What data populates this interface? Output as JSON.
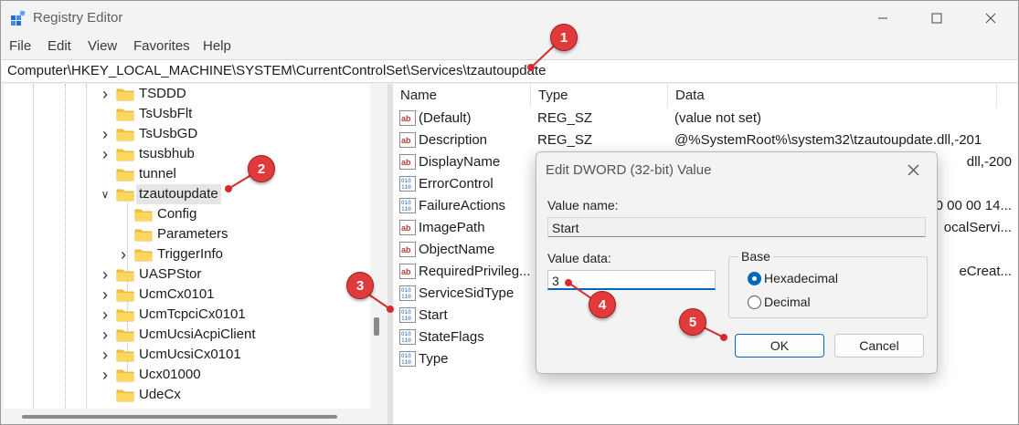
{
  "window": {
    "title": "Registry Editor",
    "minimize_icon": "minimize-icon",
    "maximize_icon": "maximize-icon",
    "close_icon": "close-icon"
  },
  "menu": [
    "File",
    "Edit",
    "View",
    "Favorites",
    "Help"
  ],
  "address": "Computer\\HKEY_LOCAL_MACHINE\\SYSTEM\\CurrentControlSet\\Services\\tzautoupdate",
  "tree": [
    {
      "label": "TSDDD",
      "has_children": true
    },
    {
      "label": "TsUsbFlt",
      "has_children": false
    },
    {
      "label": "TsUsbGD",
      "has_children": true
    },
    {
      "label": "tsusbhub",
      "has_children": true
    },
    {
      "label": "tunnel",
      "has_children": false
    },
    {
      "label": "tzautoupdate",
      "expanded": true,
      "selected": true
    },
    {
      "label": "Config",
      "child": true,
      "has_children": false
    },
    {
      "label": "Parameters",
      "child": true,
      "has_children": false
    },
    {
      "label": "TriggerInfo",
      "child": true,
      "has_children": true
    },
    {
      "label": "UASPStor",
      "has_children": true
    },
    {
      "label": "UcmCx0101",
      "has_children": true
    },
    {
      "label": "UcmTcpciCx0101",
      "has_children": true
    },
    {
      "label": "UcmUcsiAcpiClient",
      "has_children": true
    },
    {
      "label": "UcmUcsiCx0101",
      "has_children": true
    },
    {
      "label": "Ucx01000",
      "has_children": true
    },
    {
      "label": "UdeCx",
      "has_children": false
    }
  ],
  "columns": {
    "name": "Name",
    "type": "Type",
    "data": "Data"
  },
  "values": [
    {
      "name": "(Default)",
      "type": "REG_SZ",
      "data": "(value not set)",
      "kind": "string"
    },
    {
      "name": "Description",
      "type": "REG_SZ",
      "data": "@%SystemRoot%\\system32\\tzautoupdate.dll,-201",
      "kind": "string"
    },
    {
      "name": "DisplayName",
      "type": "",
      "data": "dll,-200",
      "kind": "string"
    },
    {
      "name": "ErrorControl",
      "type": "",
      "data": "",
      "kind": "binary"
    },
    {
      "name": "FailureActions",
      "type": "",
      "data": "0 00 00 14...",
      "kind": "binary"
    },
    {
      "name": "ImagePath",
      "type": "",
      "data": "ocalServi...",
      "kind": "string"
    },
    {
      "name": "ObjectName",
      "type": "",
      "data": "",
      "kind": "string"
    },
    {
      "name": "RequiredPrivileg...",
      "type": "",
      "data": "eCreat...",
      "kind": "string"
    },
    {
      "name": "ServiceSidType",
      "type": "",
      "data": "",
      "kind": "binary"
    },
    {
      "name": "Start",
      "type": "",
      "data": "",
      "kind": "binary"
    },
    {
      "name": "StateFlags",
      "type": "",
      "data": "",
      "kind": "binary"
    },
    {
      "name": "Type",
      "type": "",
      "data": "",
      "kind": "binary"
    }
  ],
  "dialog": {
    "title": "Edit DWORD (32-bit) Value",
    "value_name_label": "Value name:",
    "value_name": "Start",
    "value_data_label": "Value data:",
    "value_data": "3",
    "base_label": "Base",
    "hex_label": "Hexadecimal",
    "dec_label": "Decimal",
    "base_selected": "Hexadecimal",
    "ok_label": "OK",
    "cancel_label": "Cancel"
  },
  "callouts": [
    "1",
    "2",
    "3",
    "4",
    "5"
  ],
  "colors": {
    "callout": "#e13a3a",
    "folder": "#f5c542",
    "accent": "#0067c0"
  }
}
